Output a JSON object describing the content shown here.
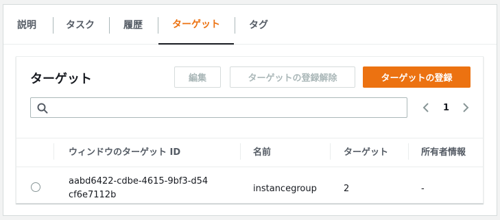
{
  "tabs": [
    {
      "label": "説明",
      "active": false
    },
    {
      "label": "タスク",
      "active": false
    },
    {
      "label": "履歴",
      "active": false
    },
    {
      "label": "ターゲット",
      "active": true
    },
    {
      "label": "タグ",
      "active": false
    }
  ],
  "panel": {
    "title": "ターゲット",
    "buttons": {
      "edit": "編集",
      "deregister": "ターゲットの登録解除",
      "register": "ターゲットの登録"
    },
    "search": {
      "placeholder": "",
      "value": ""
    },
    "pagination": {
      "current_page": "1"
    }
  },
  "table": {
    "columns": [
      "ウィンドウのターゲット ID",
      "名前",
      "ターゲット",
      "所有者情報"
    ],
    "rows": [
      {
        "id": "aabd6422-cdbe-4615-9bf3-d54cf6e7112b",
        "name": "instancegroup",
        "targets": "2",
        "owner": "-"
      }
    ]
  },
  "colors": {
    "accent": "#ec7211",
    "border": "#d5dbdb",
    "text": "#16191f",
    "muted": "#545b64"
  }
}
